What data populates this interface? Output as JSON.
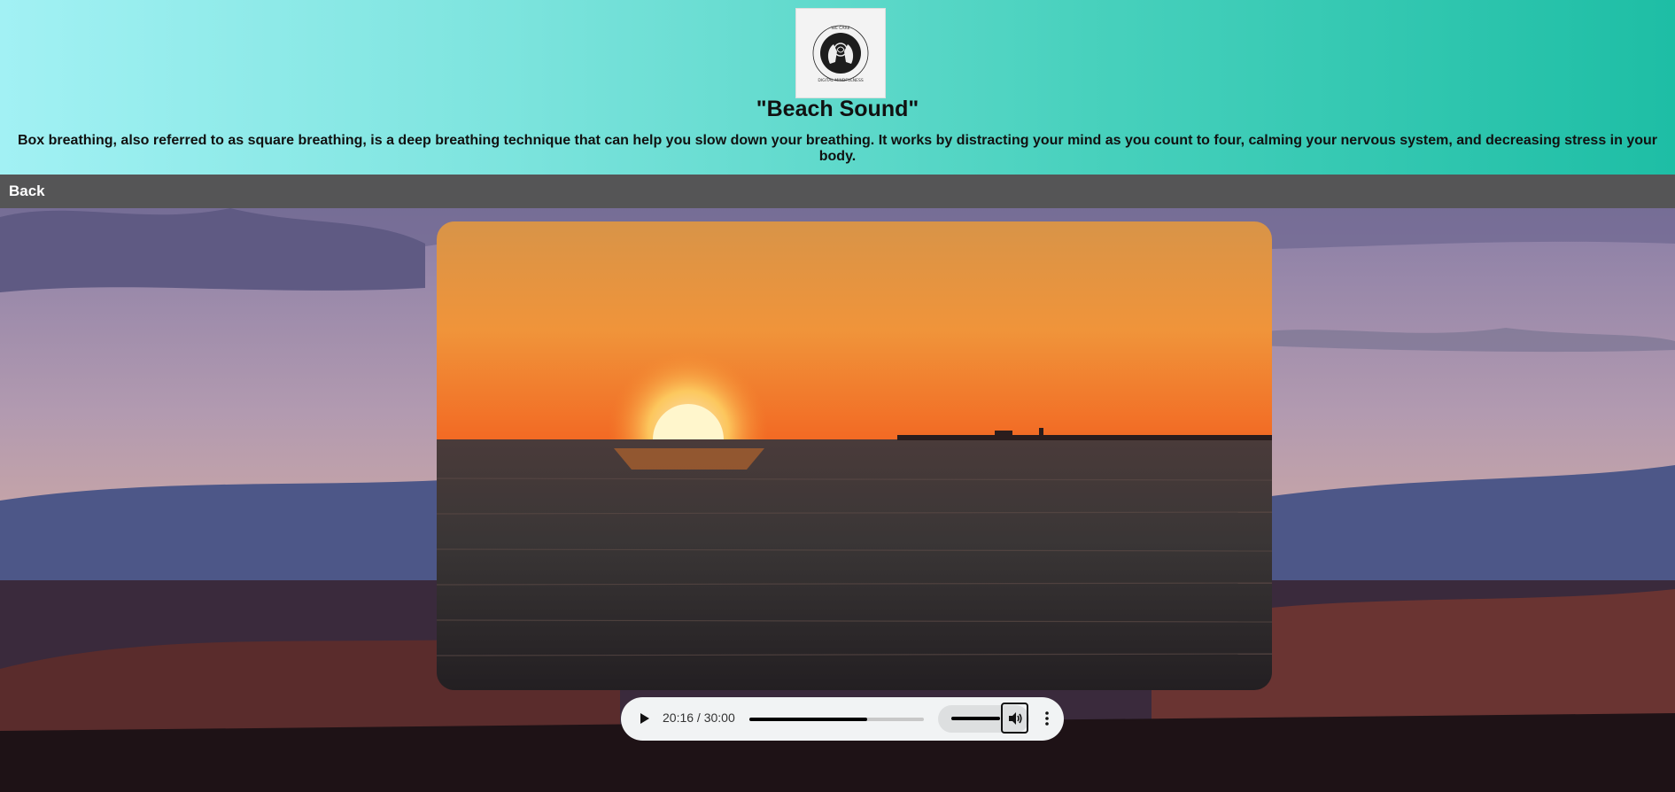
{
  "header": {
    "logo_alt": "logo",
    "title": "\"Beach Sound\"",
    "description": "Box breathing, also referred to as square breathing, is a deep breathing technique that can help you slow down your breathing. It works by distracting your mind as you count to four, calming your nervous system, and decreasing stress in your body."
  },
  "nav": {
    "back_label": "Back"
  },
  "audio_player": {
    "current_time": "20:16",
    "duration": "30:00",
    "time_display": "20:16 / 30:00",
    "progress_fraction": 0.676,
    "volume_fraction": 1.0,
    "icons": [
      "play-icon",
      "volume-icon",
      "more-options-icon"
    ]
  },
  "colors": {
    "header_gradient_start": "#a2f1f4",
    "header_gradient_end": "#1ebea5",
    "navbar": "#555556",
    "player_bg": "#f1f3f4"
  }
}
